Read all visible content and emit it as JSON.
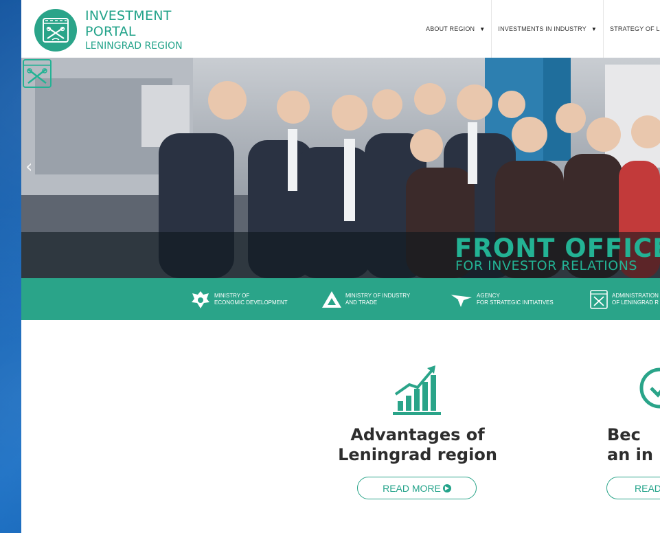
{
  "brand": {
    "line1": "INVESTMENT",
    "line2": "PORTAL",
    "line3": "LENINGRAD REGION"
  },
  "nav": {
    "items": [
      {
        "label": "ABOUT REGION",
        "has_dropdown": true
      },
      {
        "label": "INVESTMENTS IN INDUSTRY",
        "has_dropdown": true
      },
      {
        "label": "STRATEGY OF LEN",
        "has_dropdown": false
      }
    ]
  },
  "hero": {
    "prev_arrow": "‹",
    "title": "FRONT OFFICE",
    "subtitle": "FOR INVESTOR RELATIONS"
  },
  "partners": [
    {
      "icon": "double-eagle-emblem-icon",
      "text": "MINISTRY OF\nECONOMIC DEVELOPMENT"
    },
    {
      "icon": "triangle-logo-icon",
      "text": "MINISTRY OF INDUSTRY\nAND TRADE"
    },
    {
      "icon": "arrow-logo-icon",
      "text": "AGENCY\nFOR STRATEGIC INITIATIVES"
    },
    {
      "icon": "region-coat-of-arms-icon",
      "text": "ADMINISTRATION\nOF LENINGRAD R"
    }
  ],
  "features": [
    {
      "icon": "growth-chart-icon",
      "title": "Advantages of\nLeningrad region",
      "button": "READ MORE"
    },
    {
      "icon": "check-circle-icon",
      "title": "Bec\nan in",
      "button": "READ"
    }
  ],
  "colors": {
    "accent": "#2aa489",
    "brand_text": "#23a38a",
    "background": "#1a6fc4"
  }
}
